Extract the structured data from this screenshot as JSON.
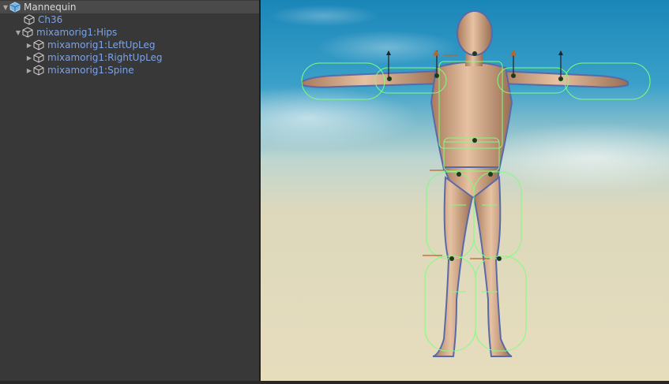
{
  "hierarchy": {
    "items": [
      {
        "label": "Mannequin",
        "indent": 0,
        "arrow": "expanded",
        "icon": "prefab-cube-icon"
      },
      {
        "label": "Ch36",
        "indent": 1,
        "arrow": "none",
        "icon": "gameobject-cube-icon"
      },
      {
        "label": "mixamorig1:Hips",
        "indent": 1,
        "arrow": "expanded",
        "icon": "gameobject-cube-icon"
      },
      {
        "label": "mixamorig1:LeftUpLeg",
        "indent": 2,
        "arrow": "collapsed",
        "icon": "gameobject-cube-icon"
      },
      {
        "label": "mixamorig1:RightUpLeg",
        "indent": 2,
        "arrow": "collapsed",
        "icon": "gameobject-cube-icon"
      },
      {
        "label": "mixamorig1:Spine",
        "indent": 2,
        "arrow": "collapsed",
        "icon": "gameobject-cube-icon"
      }
    ]
  },
  "colors": {
    "panel_bg": "#383838",
    "selected_row_bg": "#4a4a4a",
    "child_label": "#7ba3e6",
    "collider_green": "#7dff7d",
    "bone_orange": "#b8652a",
    "sky_top": "#1a86b8",
    "ground": "#e2d8b5"
  }
}
